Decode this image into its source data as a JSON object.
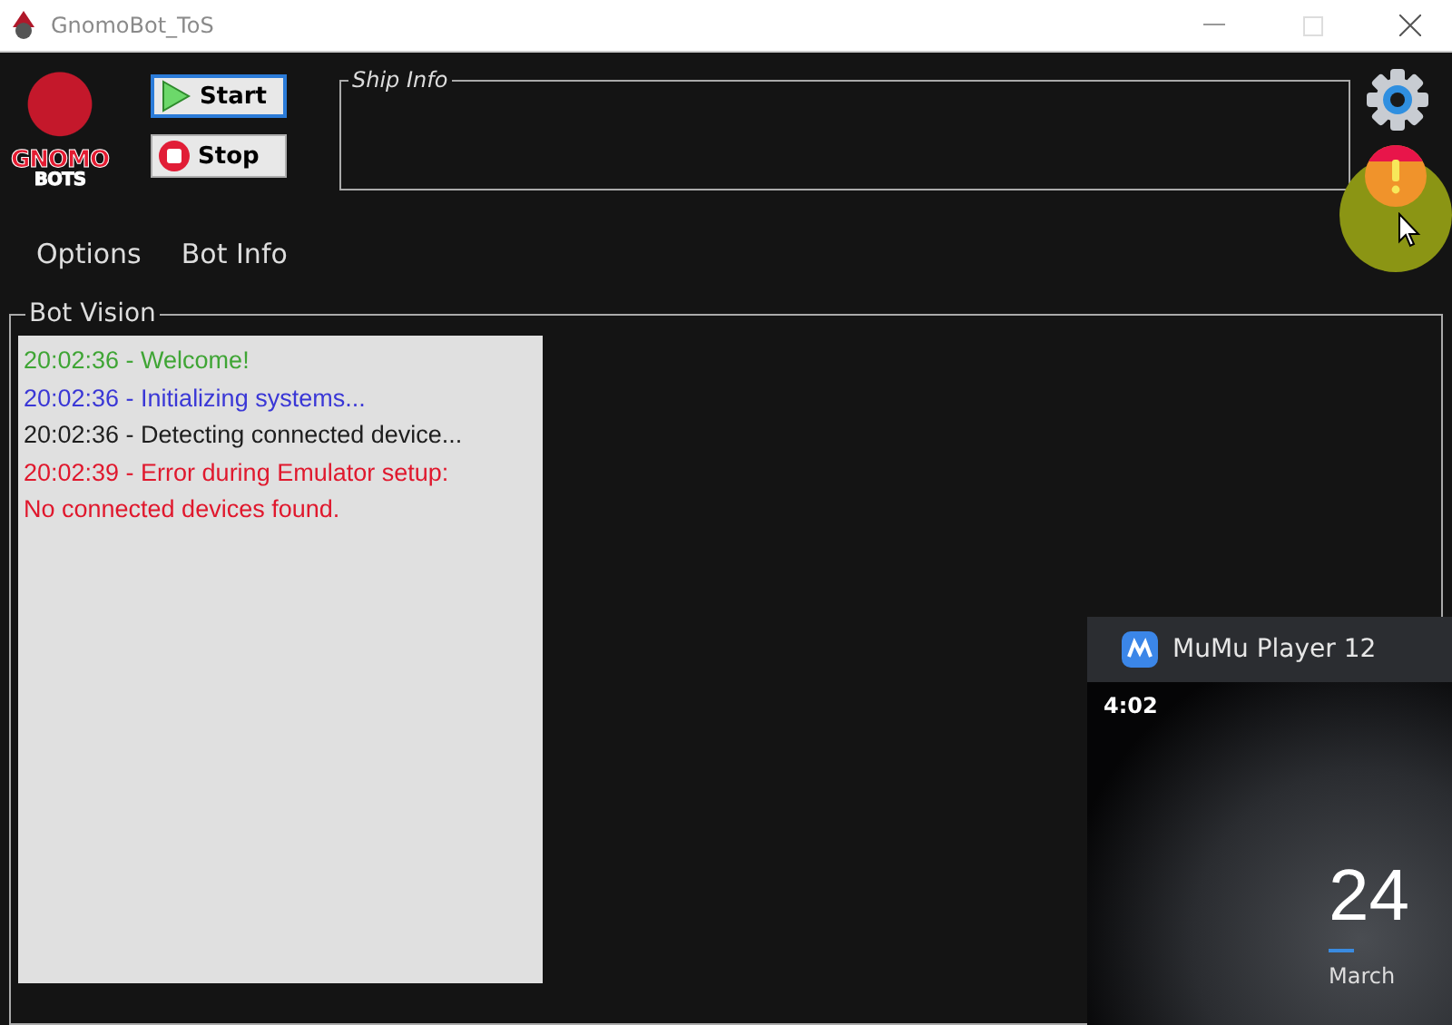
{
  "window": {
    "title": "GnomoBot_ToS"
  },
  "logo": {
    "lines": [
      "GNOMO",
      "BOTS"
    ]
  },
  "buttons": [
    {
      "kind": "start",
      "label": "Start",
      "selected": true
    },
    {
      "kind": "stop",
      "label": "Stop",
      "selected": false
    }
  ],
  "ship_info": {
    "legend": "Ship Info"
  },
  "menu": [
    {
      "label": "Options"
    },
    {
      "label": "Bot Info"
    }
  ],
  "bot_vision": {
    "legend": "Bot Vision",
    "log": [
      {
        "text": "20:02:36 - Welcome!",
        "color": "#3fa535"
      },
      {
        "text": "20:02:36 - Initializing systems...",
        "color": "#3a37d6"
      },
      {
        "text": "20:02:36 - Detecting connected device...",
        "color": "#1e1e1e"
      },
      {
        "text": "20:02:39 - Error during Emulator setup:",
        "color": "#e0182d"
      },
      {
        "text": "No connected devices found.",
        "color": "#e0182d"
      }
    ]
  },
  "mumu_window": {
    "title": "MuMu Player 12",
    "time": "4:02",
    "day": "24",
    "month": "March"
  }
}
